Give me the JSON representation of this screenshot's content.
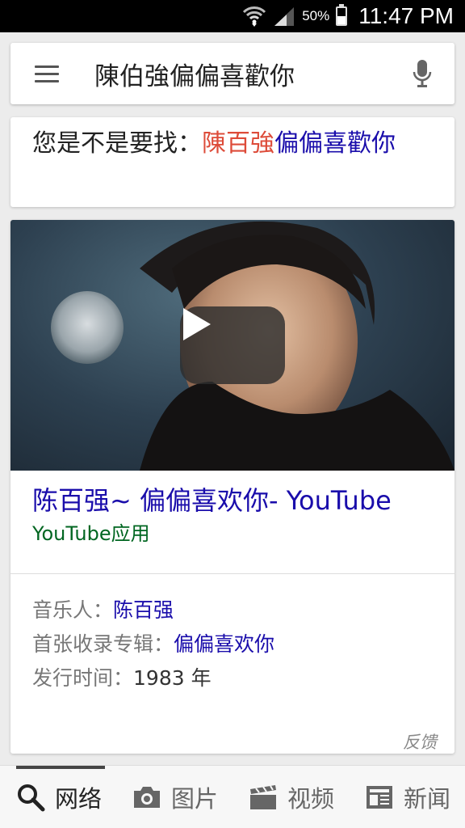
{
  "status_bar": {
    "battery_percent": "50%",
    "battery_level": 0.5,
    "time": "11:47 PM",
    "icons": [
      "wifi-icon",
      "signal-icon",
      "battery-icon"
    ]
  },
  "search": {
    "query": "陳伯強偏偏喜歡你",
    "menu_icon": "menu-icon",
    "mic_icon": "microphone-icon"
  },
  "did_you_mean": {
    "prefix": "您是不是要找：",
    "suggestion_corrected": "陳百強",
    "suggestion_rest": "偏偏喜歡你"
  },
  "video_result": {
    "title": "陈百强~ 偏偏喜欢你- YouTube",
    "source": "YouTube应用",
    "play_icon": "play-icon"
  },
  "facts": [
    {
      "label": "音乐人：",
      "value": "陈百强",
      "is_link": true
    },
    {
      "label": "首张收录专辑：",
      "value": "偏偏喜欢你",
      "is_link": true
    },
    {
      "label": "发行时间：",
      "value": "1983 年",
      "is_link": false
    }
  ],
  "feedback_label": "反馈",
  "tabs": [
    {
      "label": "网络",
      "icon": "search-icon",
      "active": true
    },
    {
      "label": "图片",
      "icon": "camera-icon",
      "active": false
    },
    {
      "label": "视频",
      "icon": "film-icon",
      "active": false
    },
    {
      "label": "新闻",
      "icon": "newspaper-icon",
      "active": false
    }
  ],
  "colors": {
    "link_blue": "#1a0dab",
    "correction_red": "#dd4b39",
    "source_green": "#006621"
  }
}
